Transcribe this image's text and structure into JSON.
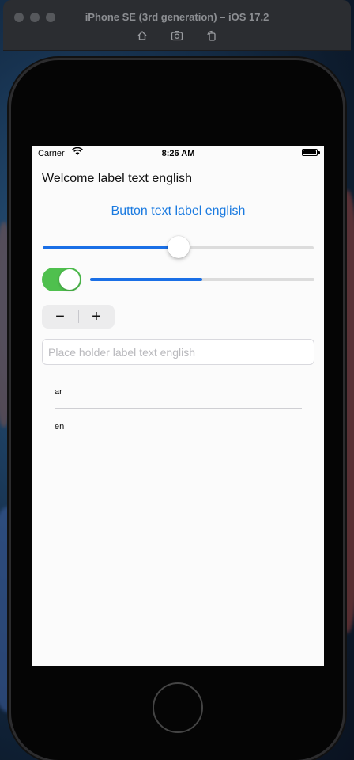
{
  "simulator": {
    "title": "iPhone SE (3rd generation) – iOS 17.2",
    "toolbar_icons": [
      "home-icon",
      "screenshot-icon",
      "rotate-icon"
    ]
  },
  "status_bar": {
    "carrier": "Carrier",
    "time": "8:26 AM"
  },
  "app": {
    "welcome_label": "Welcome label text english",
    "button_label": "Button text label english",
    "slider_value": 0.5,
    "switch_on": true,
    "progress_value": 0.5,
    "stepper": {
      "minus": "−",
      "plus": "+"
    },
    "text_field": {
      "value": "",
      "placeholder": "Place holder label text english"
    },
    "languages": [
      {
        "label": "ar"
      },
      {
        "label": "en"
      }
    ]
  },
  "colors": {
    "accent": "#1a7ae0",
    "switch_on": "#4fc04e",
    "slider_fill": "#1a6fe6"
  }
}
